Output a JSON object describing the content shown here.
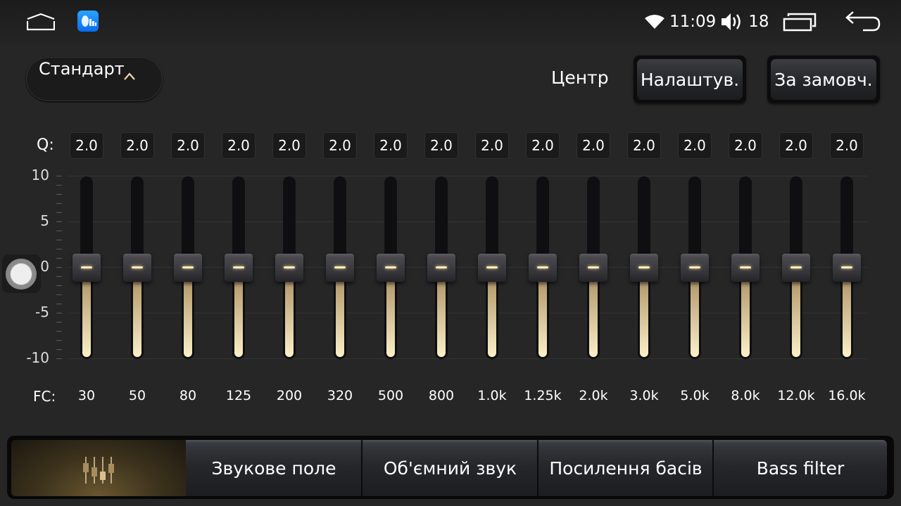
{
  "status_bar": {
    "home_icon": "home-icon",
    "app_icon": "equalizer-app-icon",
    "wifi_icon": "wifi-icon",
    "time": "11:09",
    "volume_icon": "volume-icon",
    "volume": "18",
    "recents_icon": "recents-icon",
    "back_icon": "back-icon"
  },
  "header": {
    "preset_label": "Стандарт",
    "preset_icon": "chevron-up-icon",
    "center_label": "Центр",
    "settings_button": "Налаштув.",
    "default_button": "За замовч."
  },
  "equalizer": {
    "q_label": "Q:",
    "fc_label": "FC:",
    "y_axis": [
      "10",
      "5",
      "0",
      "-5",
      "-10"
    ],
    "range": [
      -10,
      10
    ],
    "accent_color": "#f7d88a",
    "bands": [
      {
        "fc": "30",
        "q": "2.0",
        "gain": 0
      },
      {
        "fc": "50",
        "q": "2.0",
        "gain": 0
      },
      {
        "fc": "80",
        "q": "2.0",
        "gain": 0
      },
      {
        "fc": "125",
        "q": "2.0",
        "gain": 0
      },
      {
        "fc": "200",
        "q": "2.0",
        "gain": 0
      },
      {
        "fc": "320",
        "q": "2.0",
        "gain": 0
      },
      {
        "fc": "500",
        "q": "2.0",
        "gain": 0
      },
      {
        "fc": "800",
        "q": "2.0",
        "gain": 0
      },
      {
        "fc": "1.0k",
        "q": "2.0",
        "gain": 0
      },
      {
        "fc": "1.25k",
        "q": "2.0",
        "gain": 0
      },
      {
        "fc": "2.0k",
        "q": "2.0",
        "gain": 0
      },
      {
        "fc": "3.0k",
        "q": "2.0",
        "gain": 0
      },
      {
        "fc": "5.0k",
        "q": "2.0",
        "gain": 0
      },
      {
        "fc": "8.0k",
        "q": "2.0",
        "gain": 0
      },
      {
        "fc": "12.0k",
        "q": "2.0",
        "gain": 0
      },
      {
        "fc": "16.0k",
        "q": "2.0",
        "gain": 0
      }
    ]
  },
  "assistive_touch_icon": "floating-button-icon",
  "tabs": [
    {
      "label": "",
      "icon": "equalizer-sliders-icon",
      "active": true
    },
    {
      "label": "Звукове поле",
      "active": false
    },
    {
      "label": "Об'ємний звук",
      "active": false
    },
    {
      "label": "Посилення басів",
      "active": false
    },
    {
      "label": "Bass filter",
      "active": false
    }
  ]
}
